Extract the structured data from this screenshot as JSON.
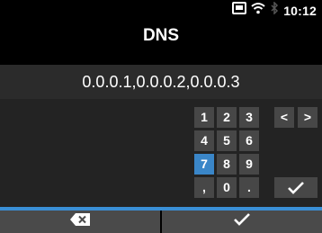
{
  "status": {
    "time": "10:12",
    "icons": [
      "sd-card-icon",
      "wifi-icon",
      "bluetooth-icon"
    ]
  },
  "title": "DNS",
  "input_value": "0.0.0.1,0.0.0.2,0.0.0.3",
  "keypad": {
    "row1": [
      "1",
      "2",
      "3",
      "<",
      ">"
    ],
    "row2": [
      "4",
      "5",
      "6"
    ],
    "row3": [
      "7",
      "8",
      "9"
    ],
    "row4": [
      ",",
      "0",
      "."
    ],
    "selected": "7",
    "enter_icon": "checkmark-icon"
  },
  "softkeys": [
    {
      "icon": "backspace-icon"
    },
    {
      "icon": "checkmark-icon"
    }
  ],
  "colors": {
    "accent": "#3a8fd6",
    "selected_key": "#3a86c8"
  }
}
